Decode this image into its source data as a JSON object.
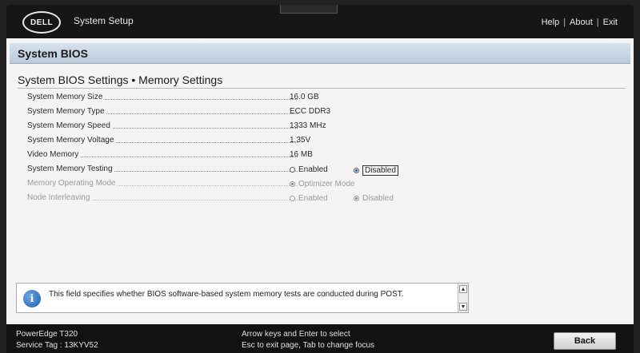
{
  "header": {
    "logo_text": "DELL",
    "title": "System Setup",
    "links": [
      "Help",
      "About",
      "Exit"
    ]
  },
  "section": {
    "title": "System BIOS"
  },
  "page": {
    "title": "System BIOS Settings • Memory Settings"
  },
  "rows": [
    {
      "label": "System Memory Size",
      "value": "16.0 GB"
    },
    {
      "label": "System Memory Type",
      "value": "ECC DDR3"
    },
    {
      "label": "System Memory Speed",
      "value": "1333 MHz"
    },
    {
      "label": "System Memory Voltage",
      "value": "1.35V"
    },
    {
      "label": "Video Memory",
      "value": "16 MB"
    }
  ],
  "memory_testing": {
    "label": "System Memory Testing",
    "options": [
      "Enabled",
      "Disabled"
    ],
    "selected": "Disabled"
  },
  "operating_mode": {
    "label": "Memory Operating Mode",
    "option": "Optimizer Mode",
    "selected": "Optimizer Mode"
  },
  "node_interleaving": {
    "label": "Node Interleaving",
    "options": [
      "Enabled",
      "Disabled"
    ],
    "selected": "Disabled"
  },
  "help": {
    "text": "This field specifies whether BIOS software-based system memory tests are conducted during POST."
  },
  "footer": {
    "model": "PowerEdge T320",
    "service_tag": "Service Tag : 13KYV52",
    "hint1": "Arrow keys and Enter to select",
    "hint2": "Esc to exit page, Tab to change focus",
    "back_label": "Back"
  },
  "colors": {
    "accent": "#1e4fa8",
    "section_bar": "#c8d5e3",
    "header_bg": "#161616"
  }
}
